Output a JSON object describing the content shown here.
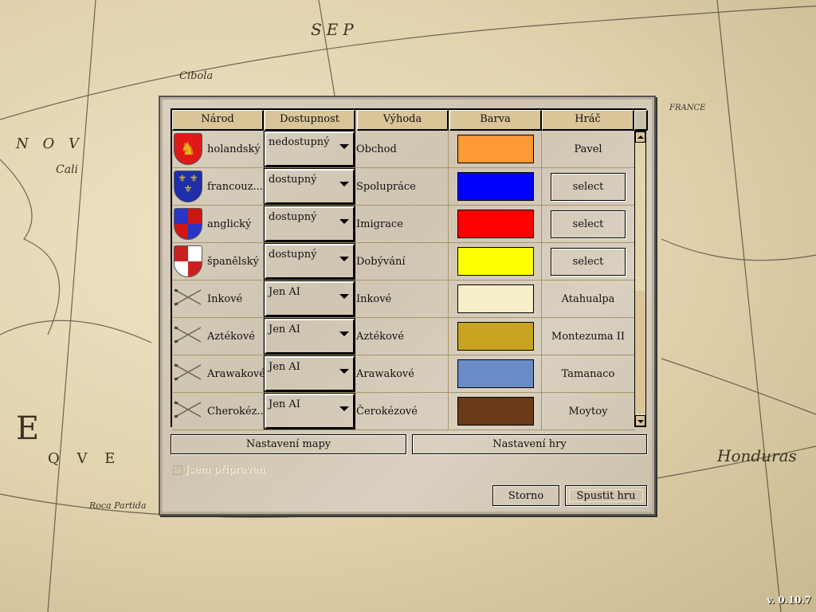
{
  "background": {
    "map_labels": [
      "Cibola",
      "SEP",
      "N O V",
      "Cali",
      "E",
      "Q V E",
      "Roca Partida",
      "FRANCE",
      "Honduras"
    ]
  },
  "version": "v. 0.10.7",
  "table": {
    "headers": [
      "Národ",
      "Dostupnost",
      "Výhoda",
      "Barva",
      "Hráč"
    ],
    "rows": [
      {
        "nation": "holandský",
        "emblem": "dutch-coat-of-arms",
        "availability": "nedostupný",
        "advantage": "Obchod",
        "color": "#ff9933",
        "player": "Pavel",
        "player_is_button": false
      },
      {
        "nation": "francouz...",
        "emblem": "french-coat-of-arms",
        "availability": "dostupný",
        "advantage": "Spolupráce",
        "color": "#0000ff",
        "player": "select",
        "player_is_button": true
      },
      {
        "nation": "anglický",
        "emblem": "english-coat-of-arms",
        "availability": "dostupný",
        "advantage": "Imigrace",
        "color": "#ff0000",
        "player": "select",
        "player_is_button": true
      },
      {
        "nation": "španělský",
        "emblem": "spanish-coat-of-arms",
        "availability": "dostupný",
        "advantage": "Dobývání",
        "color": "#ffff00",
        "player": "select",
        "player_is_button": true
      },
      {
        "nation": "Inkové",
        "emblem": "crossed-arrows",
        "availability": "Jen AI",
        "advantage": "Inkové",
        "color": "#f5f0c8",
        "player": "Atahualpa",
        "player_is_button": false
      },
      {
        "nation": "Aztékové",
        "emblem": "crossed-arrows",
        "availability": "Jen AI",
        "advantage": "Aztékové",
        "color": "#c9a422",
        "player": "Montezuma II",
        "player_is_button": false
      },
      {
        "nation": "Arawakové",
        "emblem": "crossed-arrows",
        "availability": "Jen AI",
        "advantage": "Arawakové",
        "color": "#6a8cc6",
        "player": "Tamanaco",
        "player_is_button": false
      },
      {
        "nation": "Cherokéz...",
        "emblem": "crossed-arrows",
        "availability": "Jen AI",
        "advantage": "Čerokézové",
        "color": "#6b3a18",
        "player": "Moytoy",
        "player_is_button": false
      }
    ]
  },
  "buttons": {
    "map_settings": "Nastavení mapy",
    "game_settings": "Nastavení hry",
    "cancel": "Storno",
    "start": "Spustit hru"
  },
  "ready_checkbox": {
    "label": "Jsem připraven",
    "checked": true,
    "enabled": false
  }
}
